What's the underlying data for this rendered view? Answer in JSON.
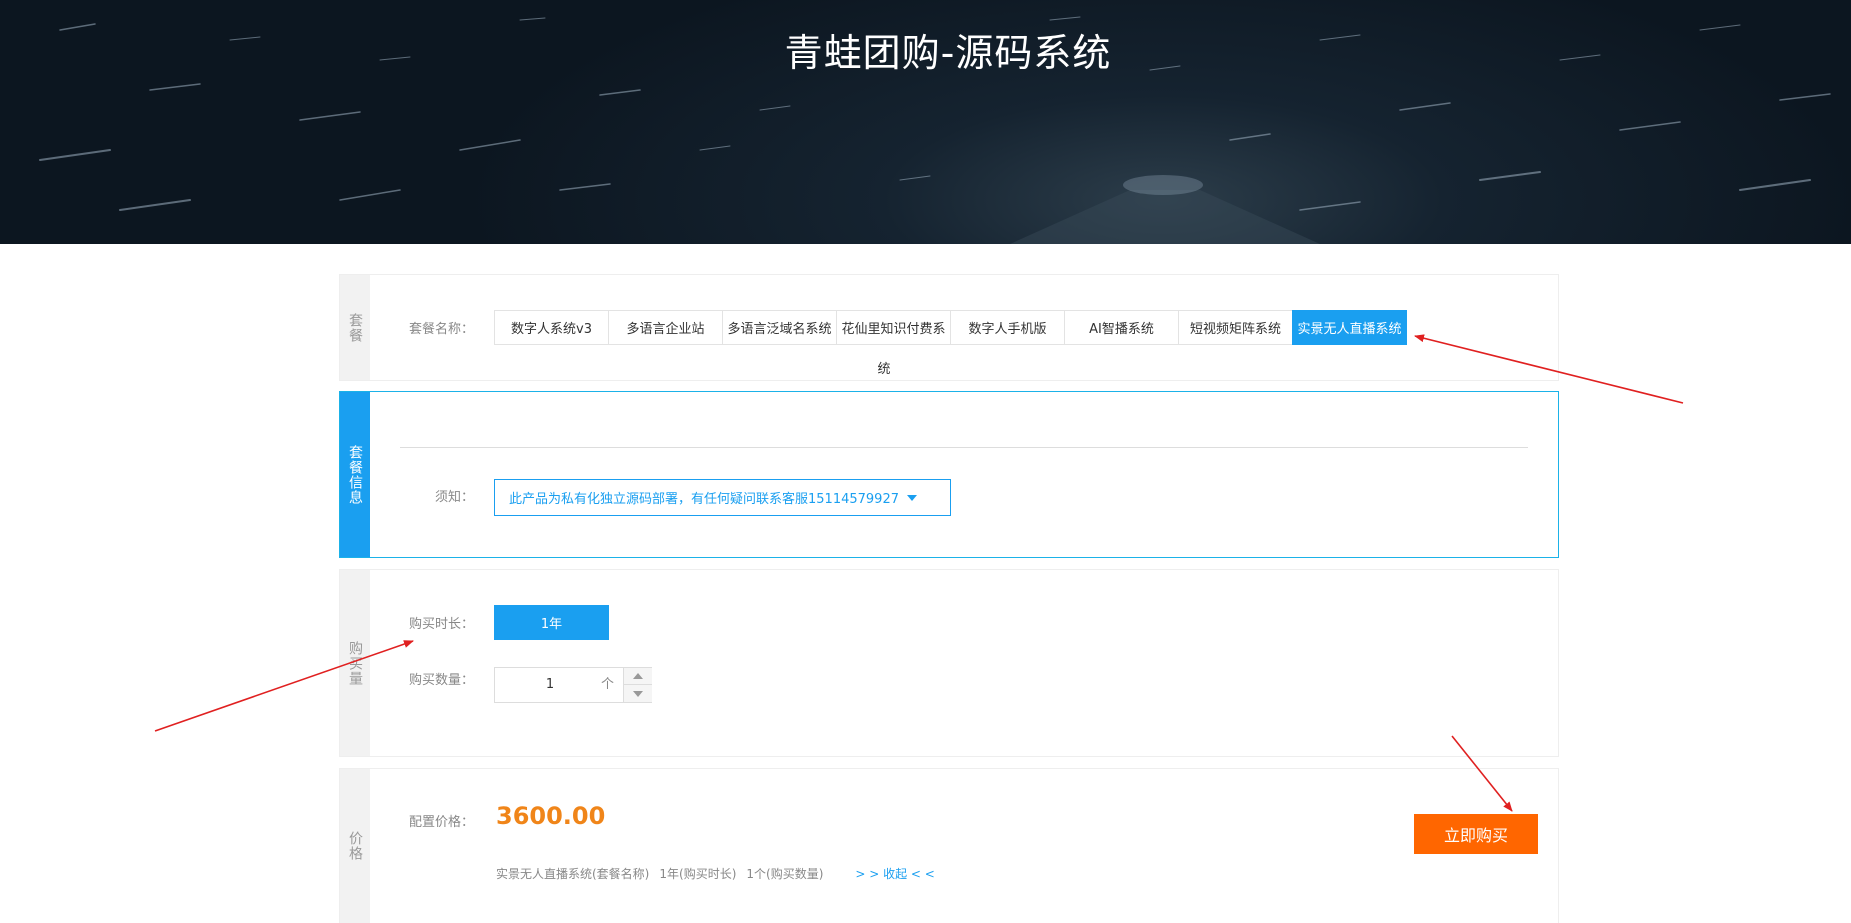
{
  "banner": {
    "title": "青蛙团购-源码系统"
  },
  "package_section": {
    "side": "套餐",
    "label": "套餐名称：",
    "options": [
      "数字人系统v3",
      "多语言企业站",
      "多语言泛域名系统",
      "花仙里知识付费系",
      "数字人手机版",
      "AI智播系统",
      "短视频矩阵系统",
      "实景无人直播系统"
    ],
    "selected_index": 7,
    "overflow_text": "统"
  },
  "info_section": {
    "side": "套餐信息",
    "label": "须知：",
    "notice": "此产品为私有化独立源码部署，有任何疑问联系客服15114579927"
  },
  "purchase_section": {
    "side": "购买量",
    "duration_label": "购买时长：",
    "duration_value": "1年",
    "quantity_label": "购买数量：",
    "quantity_value": "1",
    "quantity_unit": "个"
  },
  "price_section": {
    "side": "价格",
    "label": "配置价格：",
    "price": "3600.00",
    "buy_label": "立即购买",
    "summary": {
      "package": "实景无人直播系统(套餐名称)",
      "duration": "1年(购买时长)",
      "quantity": "1个(购买数量)",
      "collapse": "> > 收起 < <"
    }
  },
  "colors": {
    "accent": "#1a9ff0",
    "price": "#f08519",
    "buy_button": "#ff6600",
    "annotation_arrow": "#e02020"
  }
}
